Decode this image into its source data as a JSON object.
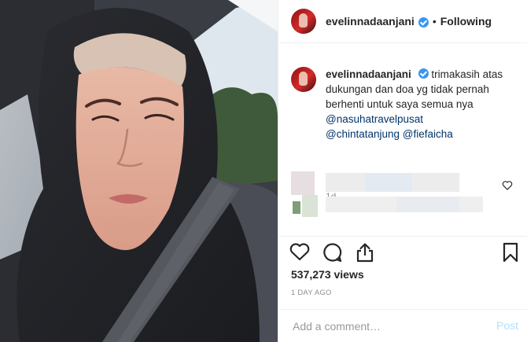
{
  "header": {
    "username": "evelinnadaanjani",
    "separator": "•",
    "follow_label": "Following"
  },
  "caption": {
    "username": "evelinnadaanjani",
    "text": "trimakasih atas dukungan dan doa yg tidak pernah berhenti untuk saya semua nya",
    "mention1": "@nasuhatravelpusat",
    "mention2": "@chintatanjung",
    "mention3": "@fiefaicha",
    "time": "1d"
  },
  "stats": {
    "views": "537,273 views",
    "posted": "1 DAY AGO"
  },
  "comment_box": {
    "placeholder": "Add a comment…",
    "post_label": "Post"
  },
  "icons": {
    "like": "heart-icon",
    "comment": "comment-bubble-icon",
    "share": "share-icon",
    "save": "bookmark-icon",
    "verified": "verified-badge-icon"
  },
  "colors": {
    "verified": "#3897f0",
    "mention": "#003569",
    "muted": "#8e8e8e",
    "post_disabled": "#b2dffc"
  }
}
